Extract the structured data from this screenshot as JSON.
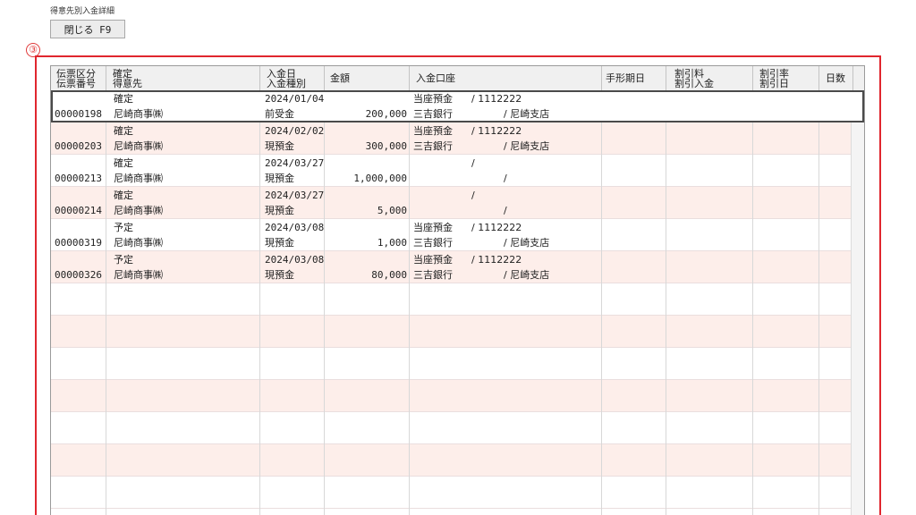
{
  "page": {
    "title": "得意先別入金詳細"
  },
  "toolbar": {
    "close_label": "閉じる F9"
  },
  "annotation": {
    "marker": "③"
  },
  "colors": {
    "highlight": "#e0262e",
    "row_alt": "#fdeeea",
    "header_bg": "#f0f0f0"
  },
  "grid": {
    "headers": {
      "slip_type": "伝票区分",
      "slip_no": "伝票番号",
      "status": "確定",
      "customer": "得意先",
      "date": "入金日",
      "kind": "入金種別",
      "amount": "金額",
      "account": "入金口座",
      "note_due": "手形期日",
      "fee": "割引料",
      "disc_deposit": "割引入金",
      "rate": "割引率",
      "disc_date": "割引日",
      "days": "日数"
    },
    "rows": [
      {
        "slip_no": "00000198",
        "status": "確定",
        "customer": "尼崎商事㈱",
        "date": "2024/01/04",
        "kind": "前受金",
        "amount": "200,000",
        "acct_type": "当座預金",
        "acct_no": "/ 1112222",
        "bank": "三吉銀行",
        "branch": "/ 尼崎支店"
      },
      {
        "slip_no": "00000203",
        "status": "確定",
        "customer": "尼崎商事㈱",
        "date": "2024/02/02",
        "kind": "現預金",
        "amount": "300,000",
        "acct_type": "当座預金",
        "acct_no": "/ 1112222",
        "bank": "三吉銀行",
        "branch": "/ 尼崎支店"
      },
      {
        "slip_no": "00000213",
        "status": "確定",
        "customer": "尼崎商事㈱",
        "date": "2024/03/27",
        "kind": "現預金",
        "amount": "1,000,000",
        "acct_type": "",
        "acct_no": "/",
        "bank": "",
        "branch": "/"
      },
      {
        "slip_no": "00000214",
        "status": "確定",
        "customer": "尼崎商事㈱",
        "date": "2024/03/27",
        "kind": "現預金",
        "amount": "5,000",
        "acct_type": "",
        "acct_no": "/",
        "bank": "",
        "branch": "/"
      },
      {
        "slip_no": "00000319",
        "status": "予定",
        "customer": "尼崎商事㈱",
        "date": "2024/03/08",
        "kind": "現預金",
        "amount": "1,000",
        "acct_type": "当座預金",
        "acct_no": "/ 1112222",
        "bank": "三吉銀行",
        "branch": "/ 尼崎支店"
      },
      {
        "slip_no": "00000326",
        "status": "予定",
        "customer": "尼崎商事㈱",
        "date": "2024/03/08",
        "kind": "現預金",
        "amount": "80,000",
        "acct_type": "当座預金",
        "acct_no": "/ 1112222",
        "bank": "三吉銀行",
        "branch": "/ 尼崎支店"
      }
    ],
    "selected_row": 0,
    "total_rows": 13
  }
}
